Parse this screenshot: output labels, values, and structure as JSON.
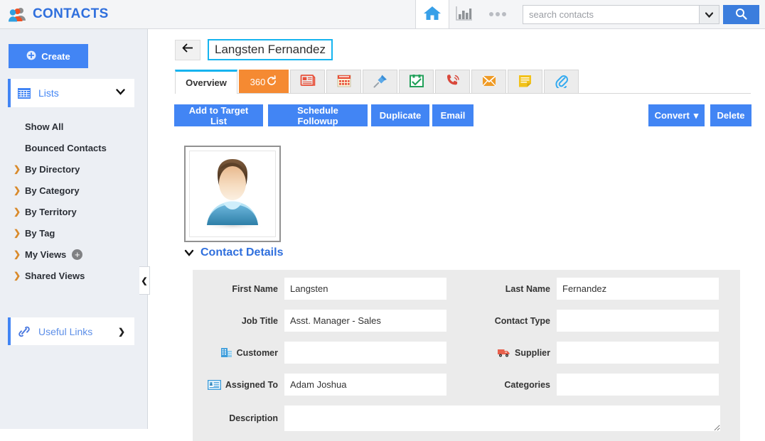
{
  "app": {
    "brand_title": "CONTACTS"
  },
  "topbar": {
    "home_icon": "home-icon",
    "chart_icon": "bar-chart-icon",
    "more_icon": "ellipsis-icon",
    "search_placeholder": "search contacts",
    "search_value": "",
    "search_caret_icon": "chevron-down-icon",
    "search_button_icon": "search-icon",
    "accent_blue": "#3b7ddd"
  },
  "sidebar": {
    "create_label": "Create",
    "create_icon": "plus-circle-icon",
    "lists": {
      "label": "Lists",
      "icon": "grid-icon",
      "chevron": "chevron-down-icon"
    },
    "items": [
      {
        "label": "Show All",
        "expandable": false
      },
      {
        "label": "Bounced Contacts",
        "expandable": false
      },
      {
        "label": "By Directory",
        "expandable": true
      },
      {
        "label": "By Category",
        "expandable": true
      },
      {
        "label": "By Territory",
        "expandable": true
      },
      {
        "label": "By Tag",
        "expandable": true
      },
      {
        "label": "My Views",
        "expandable": true,
        "badge": "+"
      },
      {
        "label": "Shared Views",
        "expandable": true
      }
    ],
    "useful_links": {
      "label": "Useful Links",
      "icon": "link-icon",
      "chevron": "chevron-right-icon"
    },
    "collapse_icon": "chevron-left-icon"
  },
  "main": {
    "back_icon": "back-arrow-icon",
    "record_title": "Langsten Fernandez",
    "tabs": [
      {
        "label": "Overview",
        "type": "text",
        "active": true
      },
      {
        "label": "360",
        "type": "text360",
        "icon": "refresh-circle-icon"
      },
      {
        "label": "",
        "type": "icon",
        "icon": "document-icon"
      },
      {
        "label": "",
        "type": "icon",
        "icon": "calendar-icon"
      },
      {
        "label": "",
        "type": "icon",
        "icon": "pin-icon"
      },
      {
        "label": "",
        "type": "icon",
        "icon": "task-check-icon"
      },
      {
        "label": "",
        "type": "icon",
        "icon": "phone-call-icon"
      },
      {
        "label": "",
        "type": "icon",
        "icon": "email-icon"
      },
      {
        "label": "",
        "type": "icon",
        "icon": "note-icon"
      },
      {
        "label": "",
        "type": "icon",
        "icon": "paperclip-icon"
      }
    ],
    "actions": {
      "add_to_target_list": "Add to Target List",
      "schedule_followup": "Schedule Followup",
      "duplicate": "Duplicate",
      "email": "Email",
      "convert": "Convert",
      "convert_caret": "▾",
      "delete": "Delete"
    },
    "avatar_icon": "default-person-avatar",
    "section": {
      "title": "Contact Details",
      "chevron": "chevron-down-icon"
    },
    "fields": {
      "first_name": {
        "label": "First Name",
        "value": "Langsten"
      },
      "last_name": {
        "label": "Last Name",
        "value": "Fernandez"
      },
      "job_title": {
        "label": "Job Title",
        "value": "Asst. Manager - Sales"
      },
      "contact_type": {
        "label": "Contact Type",
        "value": ""
      },
      "customer": {
        "label": "Customer",
        "value": "",
        "icon": "building-icon"
      },
      "supplier": {
        "label": "Supplier",
        "value": "",
        "icon": "truck-icon"
      },
      "assigned_to": {
        "label": "Assigned To",
        "value": "Adam Joshua",
        "icon": "contact-card-icon"
      },
      "categories": {
        "label": "Categories",
        "value": ""
      },
      "description": {
        "label": "Description",
        "value": ""
      }
    }
  }
}
